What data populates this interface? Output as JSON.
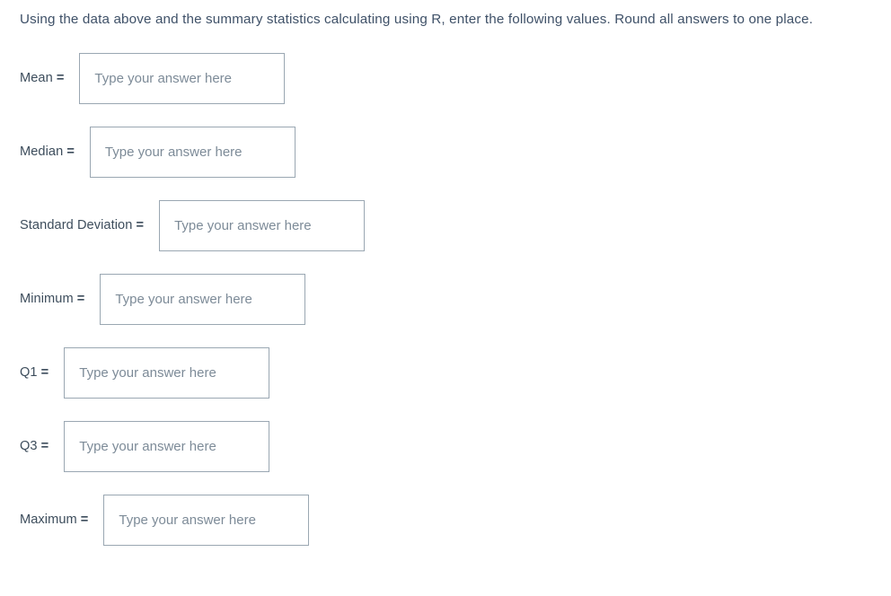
{
  "prompt": {
    "text": "Using the data above and the summary statistics calculating using R, enter the following values. Round all answers to one place."
  },
  "placeholder": "Type your answer here",
  "colors": {
    "text": "#3d4d5c",
    "prompt_text": "#3f5168",
    "input_border": "#9aa7b2",
    "placeholder_text": "#7d8b98",
    "background": "#ffffff"
  },
  "fields": [
    {
      "label": "Mean",
      "equals": "=",
      "value": "",
      "placeholder": "Type your answer here"
    },
    {
      "label": "Median",
      "equals": "=",
      "value": "",
      "placeholder": "Type your answer here"
    },
    {
      "label": "Standard Deviation",
      "equals": "=",
      "value": "",
      "placeholder": "Type your answer here"
    },
    {
      "label": "Minimum",
      "equals": "=",
      "value": "",
      "placeholder": "Type your answer here"
    },
    {
      "label": "Q1",
      "equals": "=",
      "value": "",
      "placeholder": "Type your answer here"
    },
    {
      "label": "Q3",
      "equals": "=",
      "value": "",
      "placeholder": "Type your answer here"
    },
    {
      "label": "Maximum",
      "equals": "=",
      "value": "",
      "placeholder": "Type your answer here"
    }
  ]
}
